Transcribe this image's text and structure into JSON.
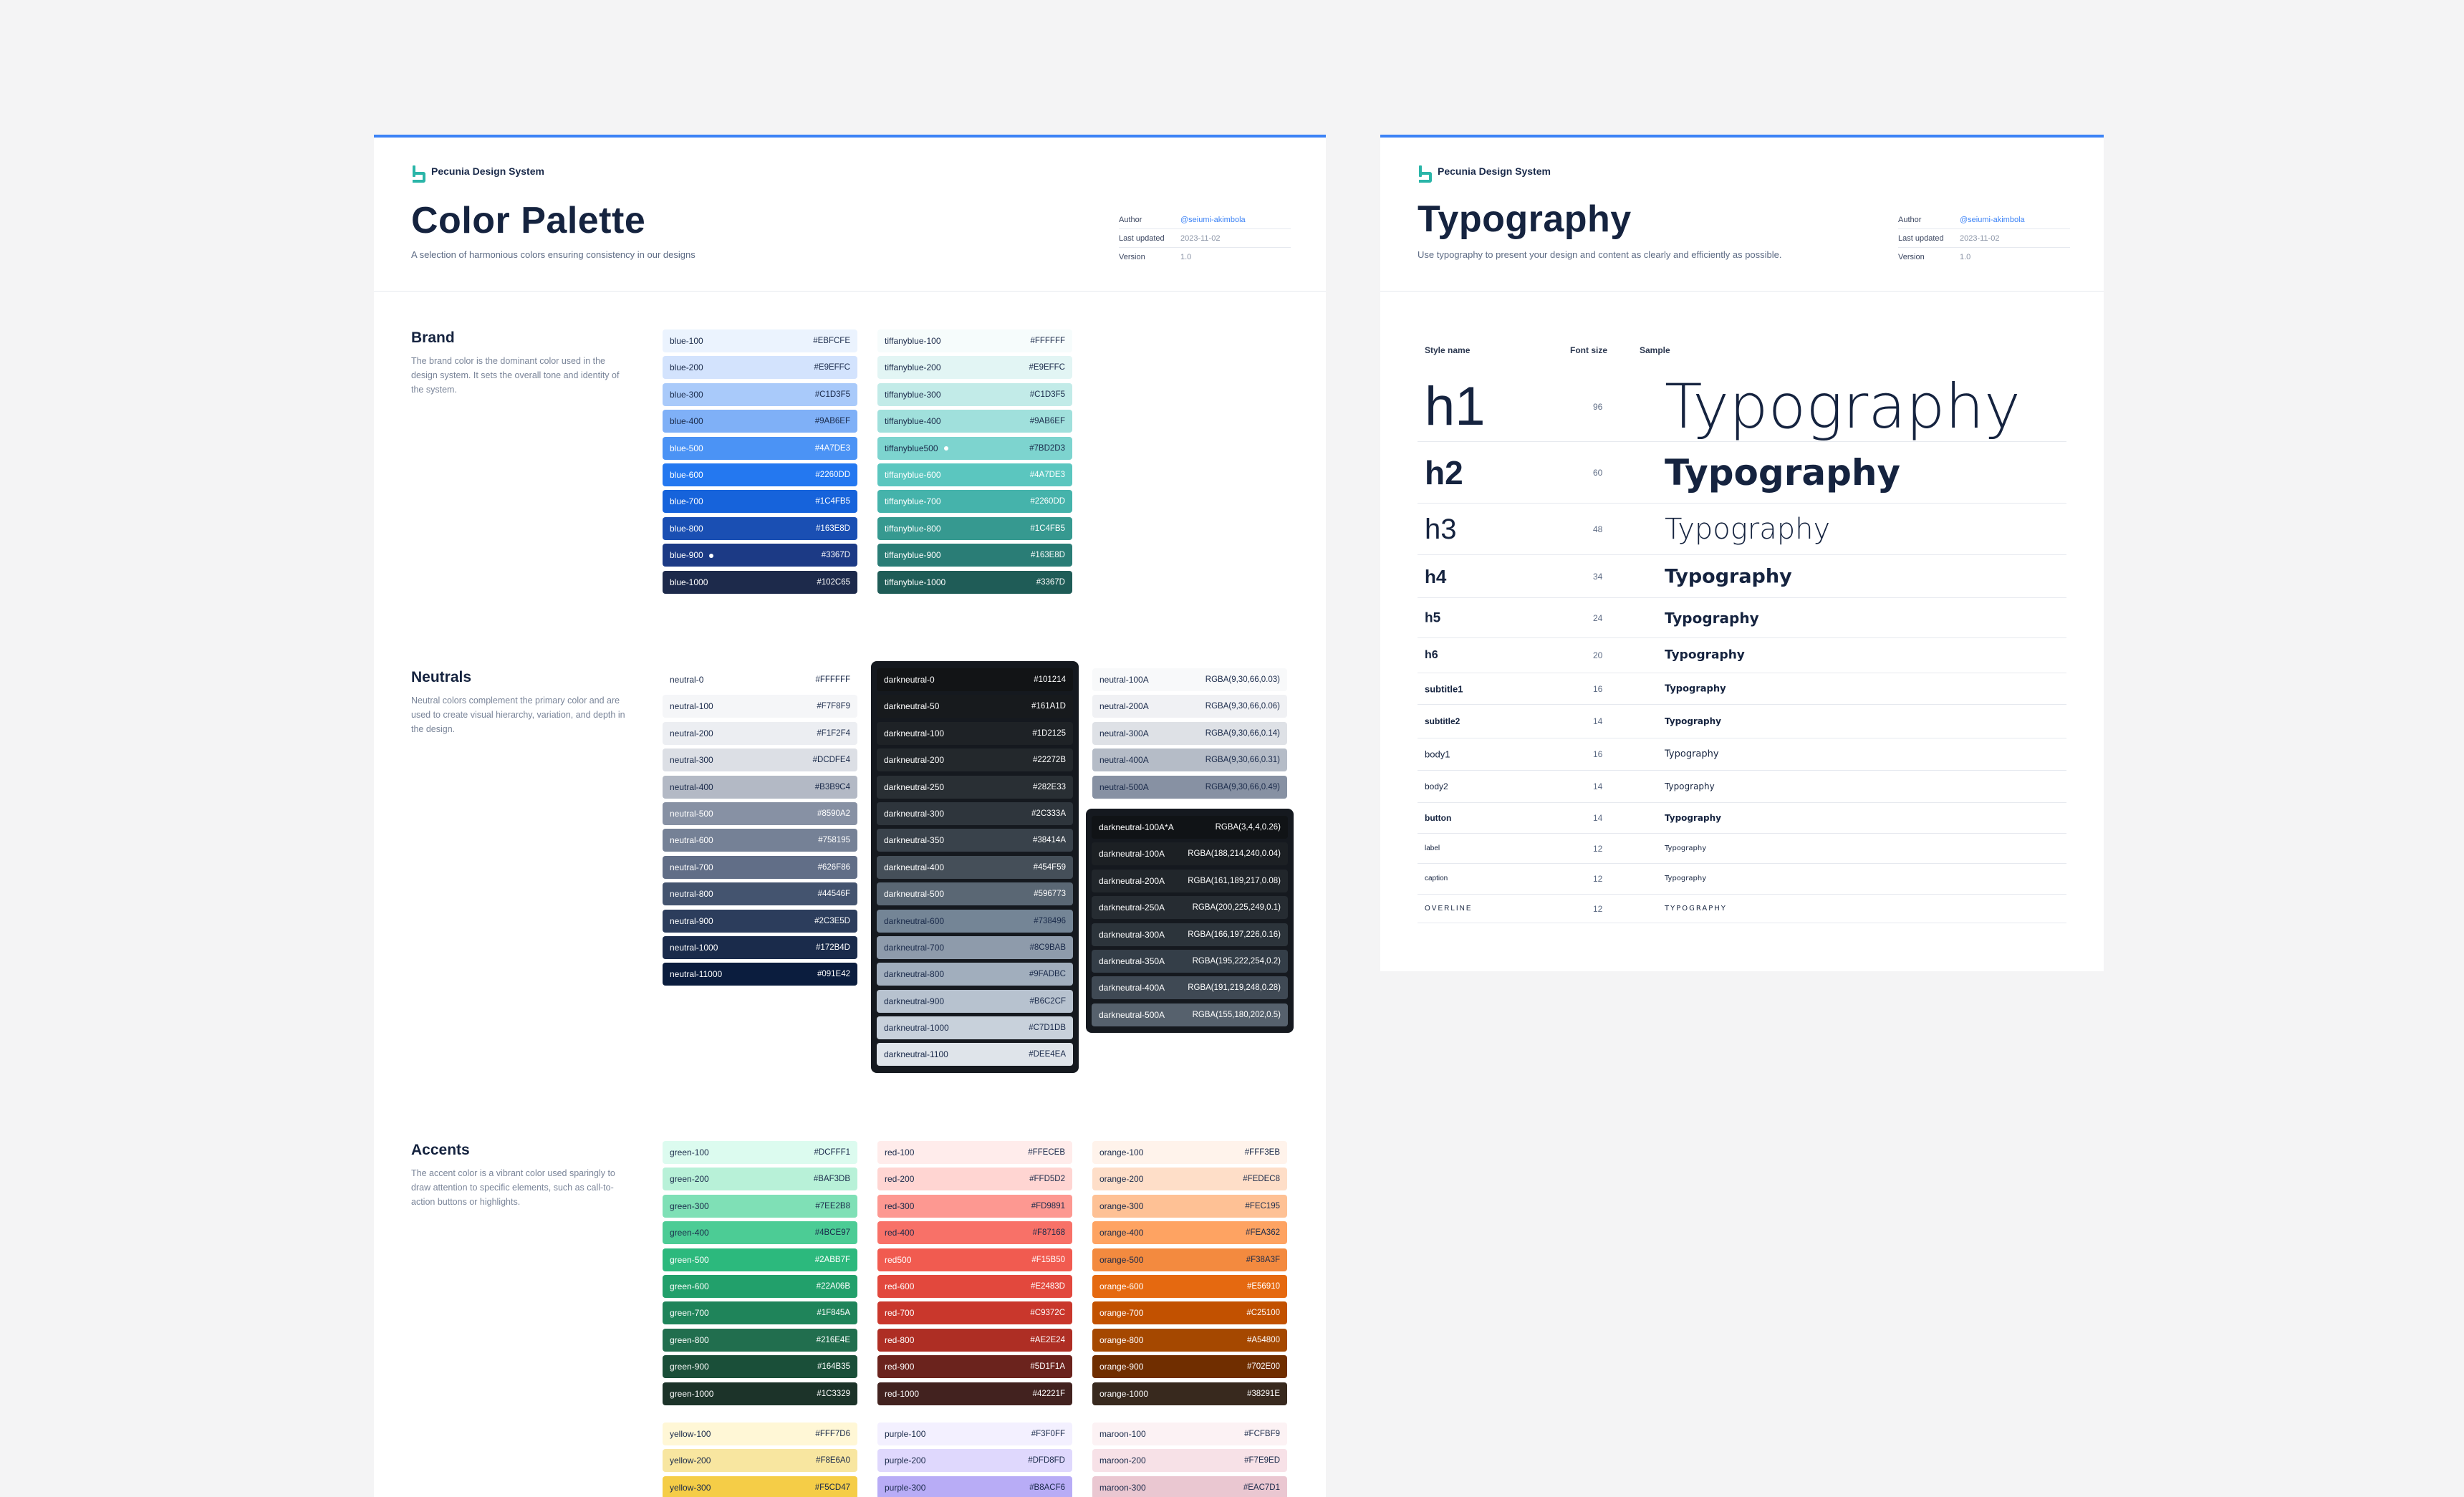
{
  "brand_name": "Pecunia Design System",
  "color_card": {
    "title": "Color Palette",
    "subtitle": "A selection of harmonious colors ensuring consistency in our designs",
    "meta": [
      {
        "key": "Author",
        "value": "@seiumi-akimbola",
        "link": true
      },
      {
        "key": "Last updated",
        "value": "2023-11-02",
        "link": false
      },
      {
        "key": "Version",
        "value": "1.0",
        "link": false
      }
    ]
  },
  "typo_card": {
    "title": "Typography",
    "subtitle": "Use typography to present your design and content as clearly and efficiently as possible.",
    "meta": [
      {
        "key": "Author",
        "value": "@seiumi-akimbola",
        "link": true
      },
      {
        "key": "Last updated",
        "value": "2023-11-02",
        "link": false
      },
      {
        "key": "Version",
        "value": "1.0",
        "link": false
      }
    ],
    "headers": {
      "style": "Style name",
      "size": "Font size",
      "sample": "Sample"
    },
    "rows": [
      {
        "name": "h1",
        "size": "96",
        "sample": "Typography"
      },
      {
        "name": "h2",
        "size": "60",
        "sample": "Typography"
      },
      {
        "name": "h3",
        "size": "48",
        "sample": "Typography"
      },
      {
        "name": "h4",
        "size": "34",
        "sample": "Typography"
      },
      {
        "name": "h5",
        "size": "24",
        "sample": "Typography"
      },
      {
        "name": "h6",
        "size": "20",
        "sample": "Typography"
      },
      {
        "name": "subtitle1",
        "size": "16",
        "sample": "Typography"
      },
      {
        "name": "subtitle2",
        "size": "14",
        "sample": "Typography"
      },
      {
        "name": "body1",
        "size": "16",
        "sample": "Typography"
      },
      {
        "name": "body2",
        "size": "14",
        "sample": "Typography"
      },
      {
        "name": "button",
        "size": "14",
        "sample": "Typography"
      },
      {
        "name": "label",
        "size": "12",
        "sample": "Typography"
      },
      {
        "name": "caption",
        "size": "12",
        "sample": "Typography"
      },
      {
        "name": "OVERLINE",
        "size": "12",
        "sample": "TYPOGRAPHY"
      }
    ]
  },
  "sections": {
    "brand": {
      "title": "Brand",
      "desc": "The brand color is the dominant color used in the design system. It sets the overall tone and identity of the system."
    },
    "neutrals": {
      "title": "Neutrals",
      "desc": "Neutral colors complement the primary color and are used to create visual hierarchy, variation, and depth in the design."
    },
    "accents": {
      "title": "Accents",
      "desc": "The accent color is a vibrant color used sparingly to draw attention to specific elements, such as call-to-action buttons or highlights."
    }
  },
  "palettes": {
    "blue": [
      {
        "name": "blue-100",
        "hex": "#EBFCFE",
        "bg": "#ebf3fe",
        "fg": "#1a2a4a"
      },
      {
        "name": "blue-200",
        "hex": "#E9EFFC",
        "bg": "#d3e3fd",
        "fg": "#1a2a4a"
      },
      {
        "name": "blue-300",
        "hex": "#C1D3F5",
        "bg": "#a9cafa",
        "fg": "#1a2a4a"
      },
      {
        "name": "blue-400",
        "hex": "#9AB6EF",
        "bg": "#7fb0f7",
        "fg": "#1a2a4a"
      },
      {
        "name": "blue-500",
        "hex": "#4A7DE3",
        "bg": "#4b93f5",
        "fg": "#ffffff"
      },
      {
        "name": "blue-600",
        "hex": "#2260DD",
        "bg": "#2478f0",
        "fg": "#ffffff"
      },
      {
        "name": "blue-700",
        "hex": "#1C4FB5",
        "bg": "#1663db",
        "fg": "#ffffff"
      },
      {
        "name": "blue-800",
        "hex": "#163E8D",
        "bg": "#1a4fb3",
        "fg": "#ffffff"
      },
      {
        "name": "blue-900",
        "hex": "#3367D",
        "bg": "#1c3a85",
        "fg": "#ffffff",
        "dot": true
      },
      {
        "name": "blue-1000",
        "hex": "#102C65",
        "bg": "#1d2a4b",
        "fg": "#ffffff"
      }
    ],
    "tiffany": [
      {
        "name": "tiffanyblue-100",
        "hex": "#FFFFFF",
        "bg": "#f6fcfc",
        "fg": "#1a2a4a"
      },
      {
        "name": "tiffanyblue-200",
        "hex": "#E9EFFC",
        "bg": "#e2f5f4",
        "fg": "#1a2a4a"
      },
      {
        "name": "tiffanyblue-300",
        "hex": "#C1D3F5",
        "bg": "#c2ebe8",
        "fg": "#1a2a4a"
      },
      {
        "name": "tiffanyblue-400",
        "hex": "#9AB6EF",
        "bg": "#a0e0dc",
        "fg": "#1a2a4a"
      },
      {
        "name": "tiffanyblue500",
        "hex": "#7BD2D3",
        "bg": "#7dd4cf",
        "fg": "#1a2a4a",
        "dot": true
      },
      {
        "name": "tiffanyblue-600",
        "hex": "#4A7DE3",
        "bg": "#5bc6bf",
        "fg": "#ffffff"
      },
      {
        "name": "tiffanyblue-700",
        "hex": "#2260DD",
        "bg": "#45b3ab",
        "fg": "#ffffff"
      },
      {
        "name": "tiffanyblue-800",
        "hex": "#1C4FB5",
        "bg": "#369990",
        "fg": "#ffffff"
      },
      {
        "name": "tiffanyblue-900",
        "hex": "#163E8D",
        "bg": "#2a7d76",
        "fg": "#ffffff"
      },
      {
        "name": "tiffanyblue-1000",
        "hex": "#3367D",
        "bg": "#1f5c57",
        "fg": "#ffffff"
      }
    ],
    "neutral": [
      {
        "name": "neutral-0",
        "hex": "#FFFFFF",
        "bg": "#ffffff",
        "fg": "#1a2a4a"
      },
      {
        "name": "neutral-100",
        "hex": "#F7F8F9",
        "bg": "#f5f6f8",
        "fg": "#1a2a4a"
      },
      {
        "name": "neutral-200",
        "hex": "#F1F2F4",
        "bg": "#eceef2",
        "fg": "#1a2a4a"
      },
      {
        "name": "neutral-300",
        "hex": "#DCDFE4",
        "bg": "#dcdfe5",
        "fg": "#1a2a4a"
      },
      {
        "name": "neutral-400",
        "hex": "#B3B9C4",
        "bg": "#b3b9c5",
        "fg": "#1a2a4a"
      },
      {
        "name": "neutral-500",
        "hex": "#8590A2",
        "bg": "#8791a4",
        "fg": "#ffffff"
      },
      {
        "name": "neutral-600",
        "hex": "#758195",
        "bg": "#758196",
        "fg": "#ffffff"
      },
      {
        "name": "neutral-700",
        "hex": "#626F86",
        "bg": "#616e87",
        "fg": "#ffffff"
      },
      {
        "name": "neutral-800",
        "hex": "#44546F",
        "bg": "#44546f",
        "fg": "#ffffff"
      },
      {
        "name": "neutral-900",
        "hex": "#2C3E5D",
        "bg": "#2c3d5c",
        "fg": "#ffffff"
      },
      {
        "name": "neutral-1000",
        "hex": "#172B4D",
        "bg": "#1a2b4b",
        "fg": "#ffffff"
      },
      {
        "name": "neutral-11000",
        "hex": "#091E42",
        "bg": "#0b1d3e",
        "fg": "#ffffff"
      }
    ],
    "darkneutral": [
      {
        "name": "darkneutral-0",
        "hex": "#101214",
        "bg": "#121416",
        "fg": "#ffffff"
      },
      {
        "name": "darkneutral-50",
        "hex": "#161A1D",
        "bg": "#171a1d",
        "fg": "#ffffff"
      },
      {
        "name": "darkneutral-100",
        "hex": "#1D2125",
        "bg": "#1e2226",
        "fg": "#ffffff"
      },
      {
        "name": "darkneutral-200",
        "hex": "#22272B",
        "bg": "#23282c",
        "fg": "#ffffff"
      },
      {
        "name": "darkneutral-250",
        "hex": "#282E33",
        "bg": "#292f34",
        "fg": "#ffffff"
      },
      {
        "name": "darkneutral-300",
        "hex": "#2C333A",
        "bg": "#2e353c",
        "fg": "#ffffff"
      },
      {
        "name": "darkneutral-350",
        "hex": "#38414A",
        "bg": "#39424b",
        "fg": "#ffffff"
      },
      {
        "name": "darkneutral-400",
        "hex": "#454F59",
        "bg": "#454f59",
        "fg": "#ffffff"
      },
      {
        "name": "darkneutral-500",
        "hex": "#596773",
        "bg": "#5a6774",
        "fg": "#ffffff"
      },
      {
        "name": "darkneutral-600",
        "hex": "#738496",
        "bg": "#748596",
        "fg": "#1a2a4a"
      },
      {
        "name": "darkneutral-700",
        "hex": "#8C9BAB",
        "bg": "#8e9bab",
        "fg": "#1a2a4a"
      },
      {
        "name": "darkneutral-800",
        "hex": "#9FADBC",
        "bg": "#a1aebd",
        "fg": "#1a2a4a"
      },
      {
        "name": "darkneutral-900",
        "hex": "#B6C2CF",
        "bg": "#b7c2cf",
        "fg": "#1a2a4a"
      },
      {
        "name": "darkneutral-1000",
        "hex": "#C7D1DB",
        "bg": "#c8d1db",
        "fg": "#1a2a4a"
      },
      {
        "name": "darkneutral-1100",
        "hex": "#DEE4EA",
        "bg": "#dfe4ea",
        "fg": "#1a2a4a"
      }
    ],
    "neutral_alpha": [
      {
        "name": "neutral-100A",
        "hex": "RGBA(9,30,66,0.03)",
        "bg": "#f8f9fa",
        "fg": "#1a2a4a"
      },
      {
        "name": "neutral-200A",
        "hex": "RGBA(9,30,66,0.06)",
        "bg": "#f0f1f4",
        "fg": "#1a2a4a"
      },
      {
        "name": "neutral-300A",
        "hex": "RGBA(9,30,66,0.14)",
        "bg": "#dee1e6",
        "fg": "#1a2a4a"
      },
      {
        "name": "neutral-400A",
        "hex": "RGBA(9,30,66,0.31)",
        "bg": "#b5bcc7",
        "fg": "#1a2a4a"
      },
      {
        "name": "neutral-500A",
        "hex": "RGBA(9,30,66,0.49)",
        "bg": "#8791a3",
        "fg": "#1a2a4a"
      }
    ],
    "darkneutral_alpha": [
      {
        "name": "darkneutral-100A*A",
        "hex": "RGBA(3,4,4,0.26)",
        "bg": "#101316",
        "fg": "#ffffff"
      },
      {
        "name": "darkneutral-100A",
        "hex": "RGBA(188,214,240,0.04)",
        "bg": "#1c2024",
        "fg": "#ffffff"
      },
      {
        "name": "darkneutral-200A",
        "hex": "RGBA(161,189,217,0.08)",
        "bg": "#21262b",
        "fg": "#ffffff"
      },
      {
        "name": "darkneutral-250A",
        "hex": "RGBA(200,225,249,0.1)",
        "bg": "#262c32",
        "fg": "#ffffff"
      },
      {
        "name": "darkneutral-300A",
        "hex": "RGBA(166,197,226,0.16)",
        "bg": "#2c343b",
        "fg": "#ffffff"
      },
      {
        "name": "darkneutral-350A",
        "hex": "RGBA(195,222,254,0.2)",
        "bg": "#343e48",
        "fg": "#ffffff"
      },
      {
        "name": "darkneutral-400A",
        "hex": "RGBA(191,219,248,0.28)",
        "bg": "#3f4954",
        "fg": "#ffffff"
      },
      {
        "name": "darkneutral-500A",
        "hex": "RGBA(155,180,202,0.5)",
        "bg": "#56616d",
        "fg": "#ffffff"
      }
    ],
    "green": [
      {
        "name": "green-100",
        "hex": "#DCFFF1",
        "bg": "#dcfbef",
        "fg": "#1a2a4a"
      },
      {
        "name": "green-200",
        "hex": "#BAF3DB",
        "bg": "#b8f1d8",
        "fg": "#1a2a4a"
      },
      {
        "name": "green-300",
        "hex": "#7EE2B8",
        "bg": "#7fe0b6",
        "fg": "#1a2a4a"
      },
      {
        "name": "green-400",
        "hex": "#4BCE97",
        "bg": "#4ccc95",
        "fg": "#1a2a4a"
      },
      {
        "name": "green-500",
        "hex": "#2ABB7F",
        "bg": "#2cb97d",
        "fg": "#ffffff"
      },
      {
        "name": "green-600",
        "hex": "#22A06B",
        "bg": "#22a06b",
        "fg": "#ffffff"
      },
      {
        "name": "green-700",
        "hex": "#1F845A",
        "bg": "#1f845a",
        "fg": "#ffffff"
      },
      {
        "name": "green-800",
        "hex": "#216E4E",
        "bg": "#216e4e",
        "fg": "#ffffff"
      },
      {
        "name": "green-900",
        "hex": "#164B35",
        "bg": "#1a4f39",
        "fg": "#ffffff"
      },
      {
        "name": "green-1000",
        "hex": "#1C3329",
        "bg": "#1c3329",
        "fg": "#ffffff"
      }
    ],
    "red": [
      {
        "name": "red-100",
        "hex": "#FFECEB",
        "bg": "#ffeceb",
        "fg": "#1a2a4a"
      },
      {
        "name": "red-200",
        "hex": "#FFD5D2",
        "bg": "#ffd5d2",
        "fg": "#1a2a4a"
      },
      {
        "name": "red-300",
        "hex": "#FD9891",
        "bg": "#fd9891",
        "fg": "#1a2a4a"
      },
      {
        "name": "red-400",
        "hex": "#F87168",
        "bg": "#f87168",
        "fg": "#1a2a4a"
      },
      {
        "name": "red500",
        "hex": "#F15B50",
        "bg": "#f15b50",
        "fg": "#ffffff"
      },
      {
        "name": "red-600",
        "hex": "#E2483D",
        "bg": "#e2483d",
        "fg": "#ffffff"
      },
      {
        "name": "red-700",
        "hex": "#C9372C",
        "bg": "#c9372c",
        "fg": "#ffffff"
      },
      {
        "name": "red-800",
        "hex": "#AE2E24",
        "bg": "#ae2e24",
        "fg": "#ffffff"
      },
      {
        "name": "red-900",
        "hex": "#5D1F1A",
        "bg": "#6b231d",
        "fg": "#ffffff"
      },
      {
        "name": "red-1000",
        "hex": "#42221F",
        "bg": "#42221f",
        "fg": "#ffffff"
      }
    ],
    "orange": [
      {
        "name": "orange-100",
        "hex": "#FFF3EB",
        "bg": "#fff3eb",
        "fg": "#1a2a4a"
      },
      {
        "name": "orange-200",
        "hex": "#FEDEC8",
        "bg": "#fedec8",
        "fg": "#1a2a4a"
      },
      {
        "name": "orange-300",
        "hex": "#FEC195",
        "bg": "#fec195",
        "fg": "#1a2a4a"
      },
      {
        "name": "orange-400",
        "hex": "#FEA362",
        "bg": "#fea362",
        "fg": "#1a2a4a"
      },
      {
        "name": "orange-500",
        "hex": "#F38A3F",
        "bg": "#f38a3f",
        "fg": "#1a2a4a"
      },
      {
        "name": "orange-600",
        "hex": "#E56910",
        "bg": "#e56910",
        "fg": "#ffffff"
      },
      {
        "name": "orange-700",
        "hex": "#C25100",
        "bg": "#c25100",
        "fg": "#ffffff"
      },
      {
        "name": "orange-800",
        "hex": "#A54800",
        "bg": "#a54800",
        "fg": "#ffffff"
      },
      {
        "name": "orange-900",
        "hex": "#702E00",
        "bg": "#702e00",
        "fg": "#ffffff"
      },
      {
        "name": "orange-1000",
        "hex": "#38291E",
        "bg": "#38291e",
        "fg": "#ffffff"
      }
    ],
    "yellow": [
      {
        "name": "yellow-100",
        "hex": "#FFF7D6",
        "bg": "#fff7d6",
        "fg": "#1a2a4a"
      },
      {
        "name": "yellow-200",
        "hex": "#F8E6A0",
        "bg": "#f8e6a0",
        "fg": "#1a2a4a"
      },
      {
        "name": "yellow-300",
        "hex": "#F5CD47",
        "bg": "#f5cd47",
        "fg": "#1a2a4a"
      }
    ],
    "purple": [
      {
        "name": "purple-100",
        "hex": "#F3F0FF",
        "bg": "#f3f0ff",
        "fg": "#1a2a4a"
      },
      {
        "name": "purple-200",
        "hex": "#DFD8FD",
        "bg": "#dfd8fd",
        "fg": "#1a2a4a"
      },
      {
        "name": "purple-300",
        "hex": "#B8ACF6",
        "bg": "#b8acf6",
        "fg": "#1a2a4a"
      }
    ],
    "maroon": [
      {
        "name": "maroon-100",
        "hex": "#FCFBF9",
        "bg": "#fcf2f4",
        "fg": "#1a2a4a"
      },
      {
        "name": "maroon-200",
        "hex": "#F7E9ED",
        "bg": "#f7e1e7",
        "fg": "#1a2a4a"
      },
      {
        "name": "maroon-300",
        "hex": "#EAC7D1",
        "bg": "#eac7d1",
        "fg": "#1a2a4a"
      }
    ]
  }
}
